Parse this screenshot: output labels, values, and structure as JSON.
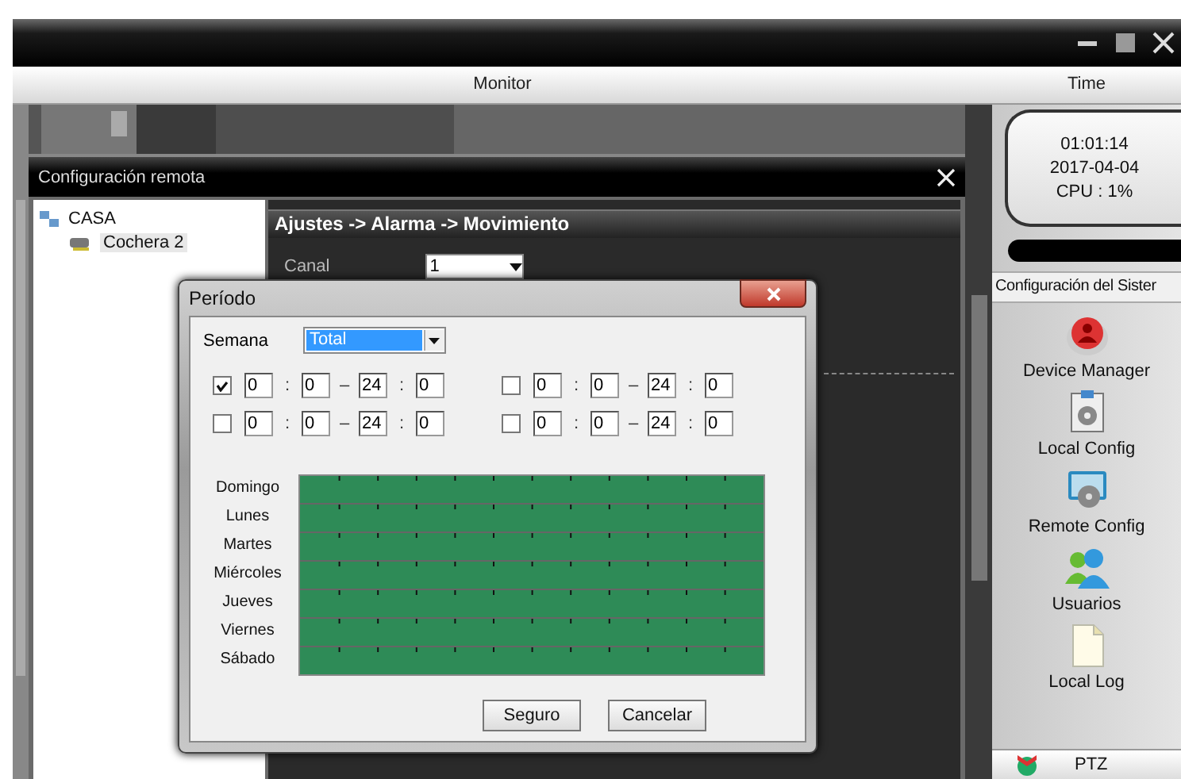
{
  "header": {
    "monitor": "Monitor",
    "time": "Time"
  },
  "clock": {
    "time": "01:01:14",
    "date": "2017-04-04",
    "cpu": "CPU : 1%"
  },
  "sidebar": {
    "title": "Configuración del Sister",
    "items": [
      {
        "label": "Device Manager",
        "kind": "device"
      },
      {
        "label": "Local Config",
        "kind": "local"
      },
      {
        "label": "Remote Config",
        "kind": "remote"
      },
      {
        "label": "Usuarios",
        "kind": "users"
      },
      {
        "label": "Local Log",
        "kind": "log"
      }
    ],
    "bottom": "PTZ"
  },
  "remote_window": {
    "title": "Configuración remota",
    "tree": [
      {
        "label": "CASA",
        "selected": false,
        "children": [
          {
            "label": "Cochera 2",
            "selected": true
          }
        ]
      }
    ],
    "breadcrumb": "Ajustes -> Alarma -> Movimiento",
    "channel": {
      "label": "Canal",
      "value": "1"
    }
  },
  "dialog": {
    "title": "Período",
    "week_label": "Semana",
    "week_value": "Total",
    "slots": [
      {
        "checked": true,
        "fields": [
          "0",
          "0",
          "24",
          "0"
        ],
        "separators": [
          ":",
          "–",
          ":"
        ]
      },
      {
        "checked": false,
        "fields": [
          "0",
          "0",
          "24",
          "0"
        ],
        "separators": [
          ":",
          "–",
          ":"
        ]
      },
      {
        "checked": false,
        "fields": [
          "0",
          "0",
          "24",
          "0"
        ],
        "separators": [
          ":",
          "–",
          ":"
        ]
      },
      {
        "checked": false,
        "fields": [
          "0",
          "0",
          "24",
          "0"
        ],
        "separators": [
          ":",
          "–",
          ":"
        ]
      }
    ],
    "days": [
      {
        "name": "Domingo",
        "level": 1
      },
      {
        "name": "Lunes",
        "level": 1
      },
      {
        "name": "Martes",
        "level": 1
      },
      {
        "name": "Miércoles",
        "level": 1
      },
      {
        "name": "Jueves",
        "level": 1
      },
      {
        "name": "Viernes",
        "level": 1
      },
      {
        "name": "Sábado",
        "level": 1
      }
    ],
    "buttons": [
      "Seguro",
      "Cancelar"
    ]
  }
}
